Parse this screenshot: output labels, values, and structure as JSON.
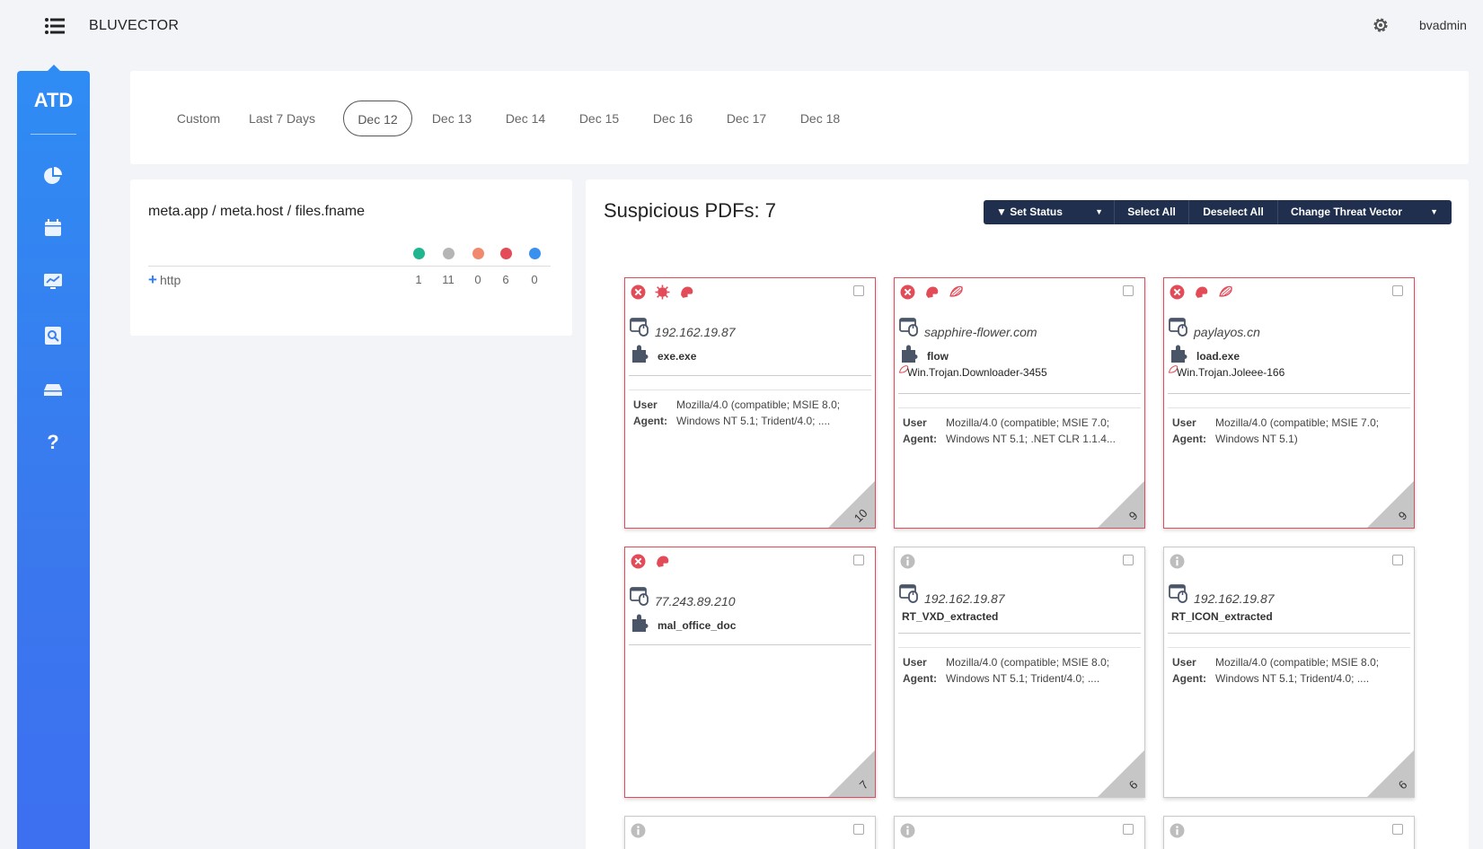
{
  "header": {
    "brand": "BLUVECTOR",
    "user": "bvadmin"
  },
  "sidebar": {
    "logo": "ATD",
    "items": [
      "pie-chart-icon",
      "calendar-icon",
      "monitor-chart-icon",
      "search-doc-icon",
      "drive-icon",
      "help-icon"
    ]
  },
  "dates": [
    "Custom",
    "Last 7 Days",
    "Dec 12",
    "Dec 13",
    "Dec 14",
    "Dec 15",
    "Dec 16",
    "Dec 17",
    "Dec 18"
  ],
  "tree": {
    "title": "meta.app / meta.host / files.fname",
    "row_label": "http",
    "counts": [
      "1",
      "11",
      "0",
      "6",
      "0"
    ]
  },
  "pdfs": {
    "title": "Suspicious PDFs: 7",
    "toolbar": {
      "set_status": "Set Status",
      "select_all": "Select All",
      "deselect_all": "Deselect All",
      "change_vector": "Change Threat Vector"
    }
  },
  "cards": [
    {
      "host": "192.162.19.87",
      "fname": "exe.exe",
      "threat": "",
      "ua1": "Mozilla/4.0 (compatible; MSIE 8.0;",
      "ua2": "Windows NT 5.1; Trident/4.0; ....",
      "score": "10"
    },
    {
      "host": "sapphire-flower.com",
      "fname": "flow",
      "threat": "Win.Trojan.Downloader-3455",
      "ua1": "Mozilla/4.0 (compatible; MSIE 7.0;",
      "ua2": "Windows NT 5.1; .NET CLR 1.1.4...",
      "score": "9"
    },
    {
      "host": "paylayos.cn",
      "fname": "load.exe",
      "threat": "Win.Trojan.Joleee-166",
      "ua1": "Mozilla/4.0 (compatible; MSIE 7.0;",
      "ua2": "Windows NT 5.1)",
      "score": "9"
    },
    {
      "host": "77.243.89.210",
      "fname": "mal_office_doc",
      "threat": "",
      "ua1": "",
      "ua2": "",
      "score": "7"
    },
    {
      "host": "192.162.19.87",
      "fname": "RT_VXD_extracted",
      "threat": "",
      "ua1": "Mozilla/4.0 (compatible; MSIE 8.0;",
      "ua2": "Windows NT 5.1; Trident/4.0; ....",
      "score": "6"
    },
    {
      "host": "192.162.19.87",
      "fname": "RT_ICON_extracted",
      "threat": "",
      "ua1": "Mozilla/4.0 (compatible; MSIE 8.0;",
      "ua2": "Windows NT 5.1; Trident/4.0; ....",
      "score": "6"
    }
  ],
  "labels": {
    "user": "User",
    "agent": "Agent:"
  },
  "colors": {
    "accent": "#2f8cf4",
    "danger": "#e24b57",
    "toolbar": "#1f2f4d"
  }
}
